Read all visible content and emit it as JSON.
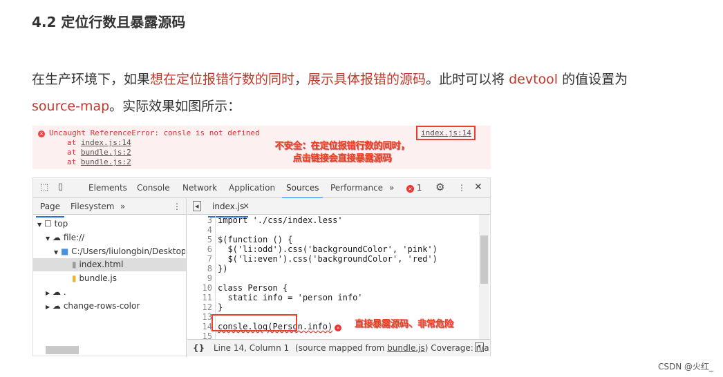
{
  "heading": "4.2 定位行数且暴露源码",
  "para": {
    "l1a": "在生产环境下，如果",
    "l1b": "想在定位报错行数的同时",
    "l1c": "，",
    "l1d": "展示具体报错的源码",
    "l1e": "。此时可以将 ",
    "l1f": "devtool",
    "l1g": " 的值设置为",
    "l2a": "source-map",
    "l2b": "。实际效果如图所示："
  },
  "console_error": {
    "message": "Uncaught ReferenceError: consle is not defined",
    "source_link": "index.js:14",
    "stack": [
      {
        "at": "at",
        "link": "index.js:14"
      },
      {
        "at": "at",
        "link": "bundle.js:2"
      },
      {
        "at": "at",
        "link": "bundle.js:2"
      }
    ]
  },
  "annotations": {
    "top_line1": "不安全：在定位报错行数的同时，",
    "top_line2": "点击链接会直接暴露源码",
    "code": "直接暴露源码、非常危险"
  },
  "devtools": {
    "tabs": [
      "Elements",
      "Console",
      "Network",
      "Application",
      "Sources",
      "Performance"
    ],
    "active_tab": "Sources",
    "more": "»",
    "error_count": "1",
    "nav_tabs": [
      "Page",
      "Filesystem"
    ],
    "nav_more": "»",
    "tree": [
      "top",
      "file://",
      "C:/Users/liulongbin/Desktop/vu",
      "index.html",
      "bundle.js",
      ".",
      "change-rows-color"
    ],
    "file_tab": "index.js",
    "file_close": "×",
    "code": [
      {
        "n": "3",
        "t": "import './css/index.less'"
      },
      {
        "n": "4",
        "t": ""
      },
      {
        "n": "5",
        "t": "$(function () {"
      },
      {
        "n": "6",
        "t": "  $('li:odd').css('backgroundColor', 'pink')"
      },
      {
        "n": "7",
        "t": "  $('li:even').css('backgroundColor', 'red')"
      },
      {
        "n": "8",
        "t": "})"
      },
      {
        "n": "9",
        "t": ""
      },
      {
        "n": "10",
        "t": "class Person {"
      },
      {
        "n": "11",
        "t": "  static info = 'person info'"
      },
      {
        "n": "12",
        "t": "}"
      },
      {
        "n": "13",
        "t": ""
      },
      {
        "n": "14",
        "t": "consle.log(Person.info)"
      },
      {
        "n": "15",
        "t": ""
      }
    ],
    "status": {
      "braces": "{}",
      "position": "Line 14, Column 1",
      "mapped_prefix": "(source mapped from ",
      "mapped_link": "bundle.js",
      "mapped_suffix": ")",
      "coverage": "Coverage: n/a"
    }
  },
  "watermark": "CSDN @火红_"
}
